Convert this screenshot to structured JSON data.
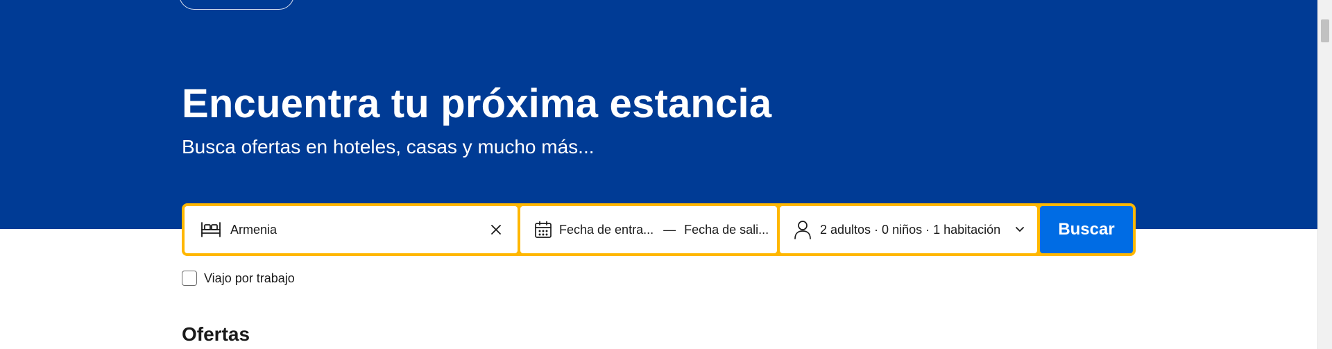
{
  "hero": {
    "title": "Encuentra tu próxima estancia",
    "subtitle": "Busca ofertas en hoteles, casas y mucho más...",
    "background_color": "#003b95"
  },
  "search": {
    "destination": {
      "icon": "bed-icon",
      "value": "Armenia",
      "clear_icon": "close-icon"
    },
    "dates": {
      "icon": "calendar-icon",
      "check_in_placeholder": "Fecha de entra...",
      "separator": "—",
      "check_out_placeholder": "Fecha de sali..."
    },
    "guests": {
      "icon": "person-icon",
      "summary": "2 adultos · 0 niños · 1 habitación",
      "dropdown_icon": "chevron-down-icon"
    },
    "button_label": "Buscar",
    "button_color": "#006ce4",
    "border_color": "#ffb700"
  },
  "business_trip": {
    "label": "Viajo por trabajo",
    "checked": false
  },
  "offers": {
    "heading": "Ofertas"
  }
}
